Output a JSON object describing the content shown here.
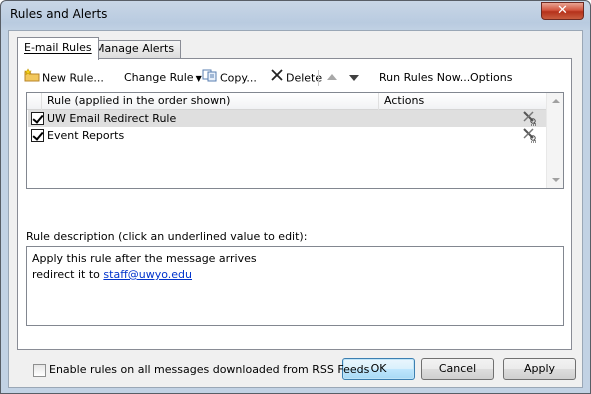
{
  "window": {
    "title": "Rules and Alerts",
    "close_glyph": "✕"
  },
  "tabs": [
    {
      "label": "E-mail Rules",
      "active": true
    },
    {
      "label": "Manage Alerts",
      "active": false
    }
  ],
  "toolbar": {
    "new_rule": "New Rule...",
    "change_rule": "Change Rule",
    "copy": "Copy...",
    "delete": "Delete",
    "run_rules_now": "Run Rules Now...",
    "options": "Options"
  },
  "rules_list": {
    "columns": [
      "Rule (applied in the order shown)",
      "Actions"
    ],
    "rows": [
      {
        "name": "UW Email Redirect Rule",
        "checked": true,
        "selected": true
      },
      {
        "name": "Event Reports",
        "checked": true,
        "selected": false
      }
    ]
  },
  "description": {
    "label": "Rule description (click an underlined value to edit):",
    "line1": "Apply this rule after the message arrives",
    "line2_prefix": "redirect it to",
    "line2_link": "staff@uwyo.edu"
  },
  "rss_option": {
    "label": "Enable rules on all messages downloaded from RSS Feeds",
    "checked": false
  },
  "buttons": {
    "ok": "OK",
    "cancel": "Cancel",
    "apply": "Apply"
  },
  "colors": {
    "selection": "#dfdfdf",
    "link": "#0033cc",
    "close_button": "#c4452c"
  }
}
